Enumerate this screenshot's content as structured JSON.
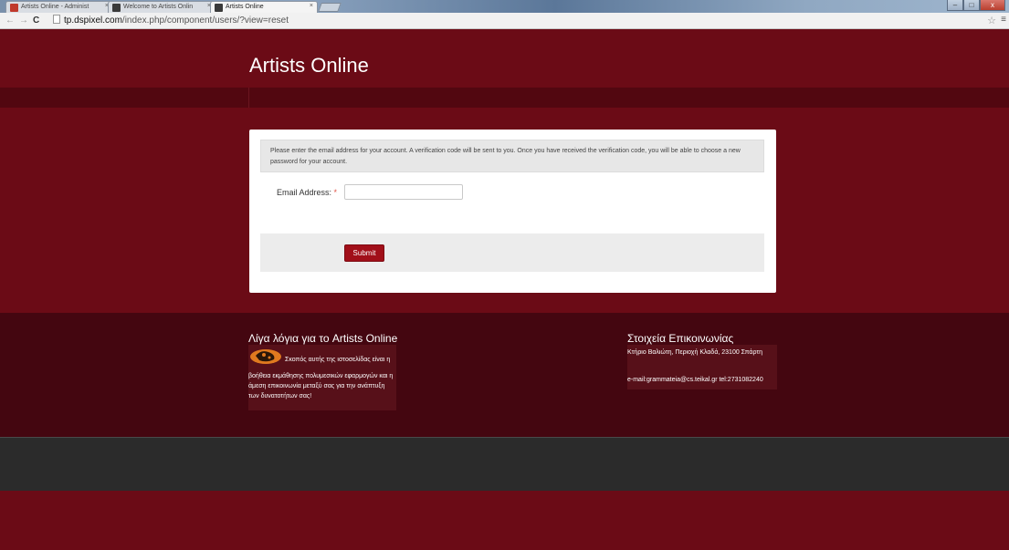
{
  "browser": {
    "tabs": [
      {
        "label": "Artists Online - Administ",
        "close": "×",
        "favicon_color": "#c0392b"
      },
      {
        "label": "Welcome to Artists Onlin",
        "close": "×",
        "favicon_color": "#3a3a3a"
      },
      {
        "label": "Artists Online",
        "close": "×",
        "favicon_color": "#3a3a3a"
      }
    ],
    "url_host": "tp.dspixel.com",
    "url_path": "/index.php/component/users/?view=reset",
    "back": "←",
    "forward": "→",
    "reload": "C",
    "star": "☆",
    "menu": "≡",
    "window_controls": {
      "minimize": "–",
      "maximize": "□",
      "close": "x"
    }
  },
  "site": {
    "title": "Artists Online"
  },
  "reset_form": {
    "notice": "Please enter the email address for your account. A verification code will be sent to you. Once you have received the verification code, you will be able to choose a new password for your account.",
    "email_label": "Email Address:",
    "required_marker": "*",
    "email_value": "",
    "submit_label": "Submit"
  },
  "footer": {
    "about": {
      "title": "Λίγα λόγια για το Artists Online",
      "first_line": "Σκοπός αυτής της ιστοσελίδας είναι η",
      "body": "βοήθεια εκμάθησης πολυμεσικών εφαρμογών και η άμεση επικοινωνία μεταξύ σας για την ανάπτυξη των δυνατοτήτων σας!"
    },
    "contact": {
      "title": "Στοιχεία Επικοινωνίας",
      "address": "Κτήριο Βαλιώτη, Περιοχή Κλαδά, 23100 Σπάρτη",
      "email_phone": "e-mail:grammateia@cs.teikal.gr tel:2731082240"
    }
  },
  "colors": {
    "brand_maroon": "#6b0b16",
    "footer_dark": "#2b2b2b",
    "submit_red": "#a10f19"
  }
}
